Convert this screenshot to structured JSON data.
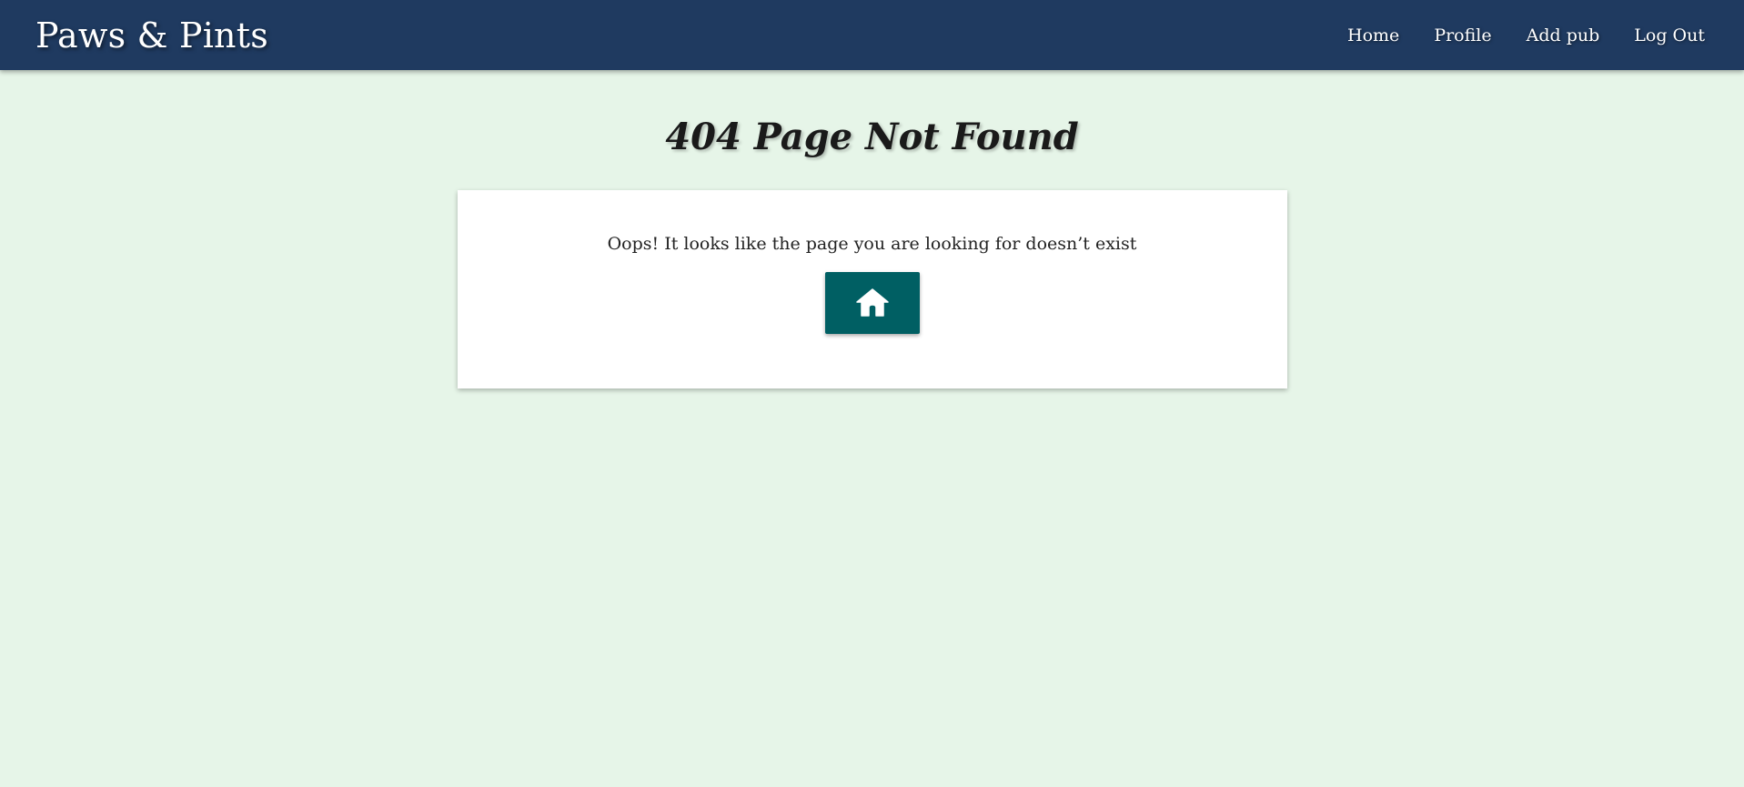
{
  "navbar": {
    "brand": "Paws & Pints",
    "links": [
      {
        "label": "Home"
      },
      {
        "label": "Profile"
      },
      {
        "label": "Add pub"
      },
      {
        "label": "Log Out"
      }
    ],
    "background": "#1f3a60"
  },
  "main": {
    "title": "404 Page Not Found",
    "message": "Oops! It looks like the page you are looking for doesn’t exist",
    "home_button_icon": "home-icon",
    "button_color": "#005f63",
    "background": "#e6f5e8"
  }
}
